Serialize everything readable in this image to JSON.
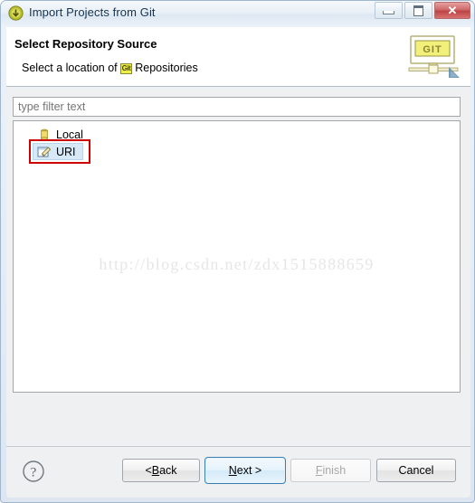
{
  "window": {
    "title": "Import Projects from Git",
    "icon": "git-import-wizard-icon",
    "controls": {
      "minimize": "minimize-button",
      "maximize": "maximize-button",
      "close_label": "✕"
    }
  },
  "banner": {
    "title": "Select Repository Source",
    "description_before": "Select a location of",
    "description_chip": "Git",
    "description_after": "Repositories",
    "icon": "git-repository-banner-icon",
    "icon_text": "GIT"
  },
  "filter": {
    "placeholder": "type filter text",
    "value": ""
  },
  "tree": {
    "items": [
      {
        "label": "Local",
        "icon": "local-repository-icon",
        "selected": false
      },
      {
        "label": "URI",
        "icon": "uri-edit-icon",
        "selected": true
      }
    ]
  },
  "annotation": {
    "target": "URI",
    "color": "#cc0000"
  },
  "watermark": {
    "text": "http://blog.csdn.net/zdx1515888659"
  },
  "buttons": {
    "help": "?",
    "back": {
      "pre": "< ",
      "mnemonic": "B",
      "post": "ack",
      "enabled": true
    },
    "next": {
      "pre": "",
      "mnemonic": "N",
      "post": "ext >",
      "enabled": true,
      "default": true
    },
    "finish": {
      "pre": "",
      "mnemonic": "F",
      "post": "inish",
      "enabled": false
    },
    "cancel": {
      "pre": "",
      "mnemonic": "",
      "post": "Cancel",
      "enabled": true
    }
  },
  "colors": {
    "selection": "#d7e8f6",
    "annotation": "#cc0000",
    "default_button_border": "#3c7fb1",
    "git_chip": "#eeee44"
  }
}
